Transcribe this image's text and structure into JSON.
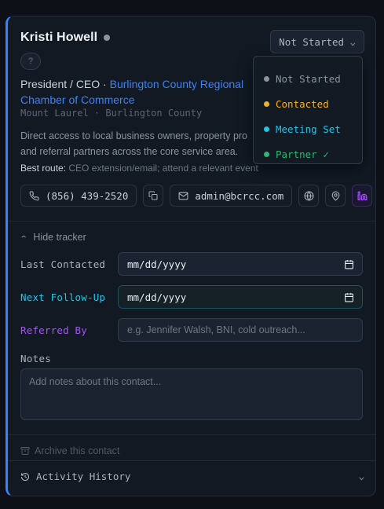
{
  "contact": {
    "name": "Kristi Howell",
    "badge": "?",
    "role": "President / CEO",
    "separator": "·",
    "org": "Burlington County Regional Chamber of Commerce",
    "location": "Mount Laurel · Burlington County",
    "description_line1": "Direct access to local business owners, property pro",
    "description_line2": "and referral partners across the core service area.",
    "best_route_label": "Best route:",
    "best_route_value": "CEO extension/email; attend a relevant event",
    "phone": "(856) 439-2520",
    "email": "admin@bcrcc.com"
  },
  "status": {
    "current": "Not Started",
    "options": [
      {
        "label": "Not Started",
        "color": "#8b949e"
      },
      {
        "label": "Contacted",
        "color": "#f5b21b"
      },
      {
        "label": "Meeting Set",
        "color": "#22c3e6"
      },
      {
        "label": "Partner ✓",
        "color": "#2bb673"
      }
    ]
  },
  "tracker": {
    "toggle_label": "Hide tracker",
    "last_contacted_label": "Last Contacted",
    "last_contacted_value": "mm/dd/yyyy",
    "next_followup_label": "Next Follow-Up",
    "next_followup_value": "mm/dd/yyyy",
    "referred_by_label": "Referred By",
    "referred_by_placeholder": "e.g. Jennifer Walsh, BNI, cold outreach...",
    "notes_label": "Notes",
    "notes_placeholder": "Add notes about this contact..."
  },
  "footer": {
    "archive_label": "Archive this contact",
    "activity_label": "Activity History"
  },
  "colors": {
    "accent": "#3b82f6",
    "followup": "#22c3e6",
    "referred": "#a855f7"
  }
}
